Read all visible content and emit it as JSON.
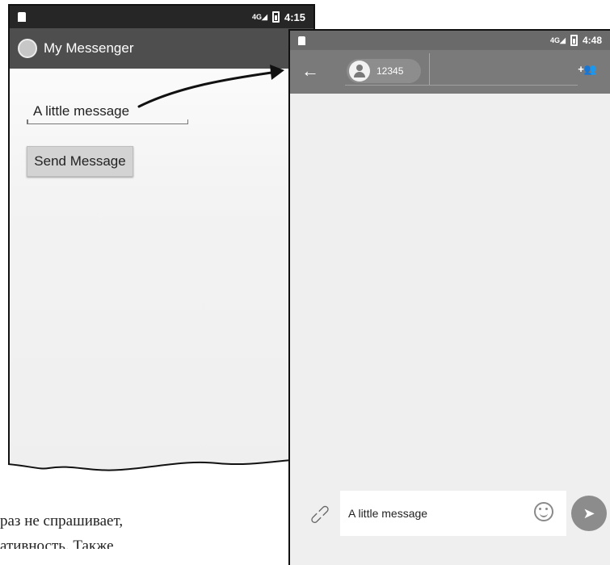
{
  "left_screen": {
    "status_time": "4:15",
    "network": "4G",
    "app_title": "My Messenger",
    "message_field_value": "A little message",
    "send_button_label": "Send Message"
  },
  "right_screen": {
    "status_time": "4:48",
    "network": "4G",
    "recipient": "12345",
    "compose_text": "A little message"
  },
  "book_text": {
    "line1": "раз не спрашивает,",
    "line2": "ативность. Также"
  },
  "icons": {
    "sd_card": "sd-card-icon",
    "signal": "signal-icon",
    "battery": "battery-icon",
    "back": "back-arrow-icon",
    "person": "person-icon",
    "add_person": "add-person-icon",
    "attach": "attachment-icon",
    "emoji": "emoji-icon",
    "send": "send-icon"
  }
}
